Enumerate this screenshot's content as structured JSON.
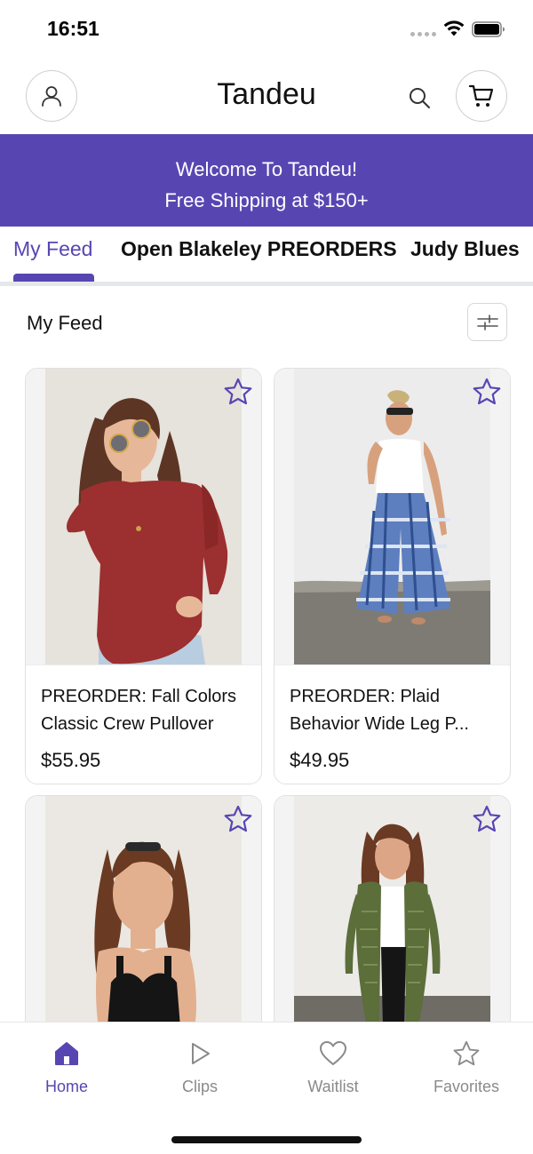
{
  "status_bar": {
    "time": "16:51"
  },
  "header": {
    "title": "Tandeu"
  },
  "banner": {
    "line1": "Welcome To Tandeu!",
    "line2": "Free Shipping at $150+"
  },
  "tabs": [
    {
      "label": "My Feed",
      "active": true
    },
    {
      "label": "Open Blakeley PREORDERS",
      "active": false
    },
    {
      "label": "Judy Blues",
      "active": false
    }
  ],
  "section": {
    "title": "My Feed"
  },
  "products": [
    {
      "name": "PREORDER: Fall Colors Classic Crew Pullover",
      "price": "$55.95"
    },
    {
      "name": "PREORDER: Plaid Behavior Wide Leg P...",
      "price": "$49.95"
    },
    {
      "name": "",
      "price": ""
    },
    {
      "name": "",
      "price": ""
    }
  ],
  "bottom_nav": [
    {
      "label": "Home",
      "icon": "home-icon",
      "active": true
    },
    {
      "label": "Clips",
      "icon": "play-icon",
      "active": false
    },
    {
      "label": "Waitlist",
      "icon": "heart-icon",
      "active": false
    },
    {
      "label": "Favorites",
      "icon": "star-icon",
      "active": false
    }
  ],
  "colors": {
    "accent": "#5746b2",
    "inactive": "#8a8a8a",
    "border": "#e1e1e1"
  }
}
